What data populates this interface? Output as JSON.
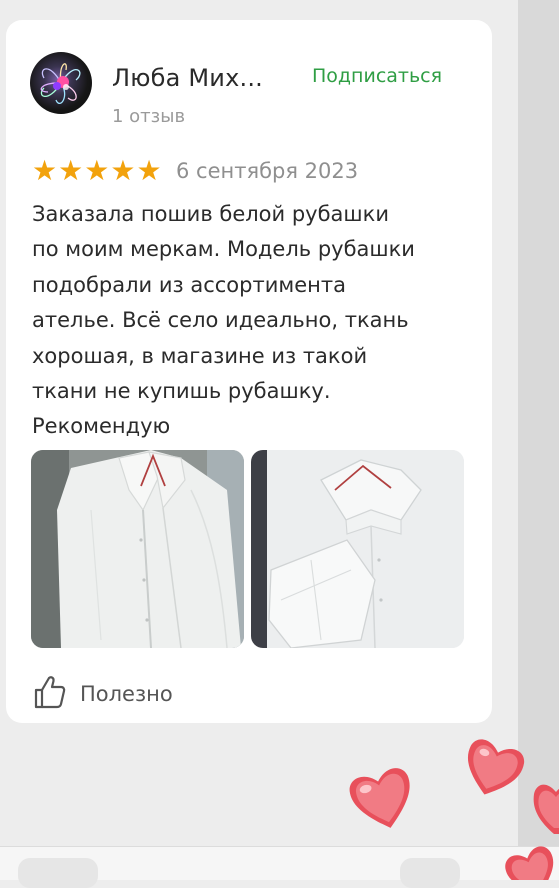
{
  "review": {
    "author_name": "Люба Мих...",
    "review_count": "1 отзыв",
    "subscribe_label": "Подписаться",
    "rating": 5,
    "rating_max": 5,
    "date": "6 сентября 2023",
    "text_lines": [
      "Заказала пошив белой рубашки",
      "по моим меркам. Модель рубашки",
      "подобрали из ассортимента",
      "ателье. Всё село идеально, ткань",
      "хорошая, в магазине из такой",
      "ткани не купишь рубашку.",
      "Рекомендую"
    ],
    "helpful_label": "Полезно"
  },
  "photos": [
    {
      "subject": "white shirt on hanger, front view"
    },
    {
      "subject": "white shirt on hanger, collar and cuff close-up"
    }
  ],
  "colors": {
    "accent_green": "#2f9e44",
    "star_color": "#f2a20c",
    "card_background": "#ffffff",
    "page_background": "#ededed",
    "heart_color": "#e8505b"
  },
  "icons": {
    "helpful": "thumbs-up-icon",
    "rating": "star-icon",
    "decoration": "heart-sticker"
  }
}
